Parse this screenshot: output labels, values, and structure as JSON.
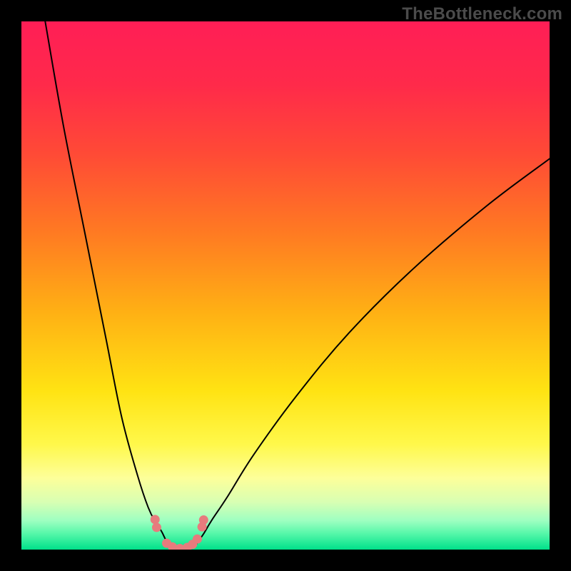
{
  "watermark": "TheBottleneck.com",
  "colors": {
    "frame": "#000000",
    "gradient_stops": [
      {
        "offset": 0.0,
        "color": "#ff1e56"
      },
      {
        "offset": 0.12,
        "color": "#ff2a4a"
      },
      {
        "offset": 0.25,
        "color": "#ff4a36"
      },
      {
        "offset": 0.4,
        "color": "#ff7a22"
      },
      {
        "offset": 0.55,
        "color": "#ffb014"
      },
      {
        "offset": 0.7,
        "color": "#ffe313"
      },
      {
        "offset": 0.8,
        "color": "#fff84a"
      },
      {
        "offset": 0.865,
        "color": "#fdff9a"
      },
      {
        "offset": 0.91,
        "color": "#d8ffb3"
      },
      {
        "offset": 0.945,
        "color": "#9effc1"
      },
      {
        "offset": 0.97,
        "color": "#55f7a9"
      },
      {
        "offset": 1.0,
        "color": "#00e08a"
      }
    ],
    "curve_stroke": "#000000",
    "marker_fill": "#e77b7d",
    "marker_stroke": "#e77b7d"
  },
  "chart_data": {
    "type": "line",
    "title": "",
    "xlabel": "",
    "ylabel": "",
    "xlim": [
      0,
      100
    ],
    "ylim": [
      0,
      100
    ],
    "series": [
      {
        "name": "left-curve",
        "x": [
          4.5,
          8,
          12,
          16,
          19,
          22,
          24,
          25.5,
          26.5,
          27.0,
          27.5,
          28.0
        ],
        "values": [
          100,
          80,
          60,
          40,
          25,
          14,
          8,
          5,
          3.5,
          2.5,
          1.5,
          0.8
        ]
      },
      {
        "name": "right-curve",
        "x": [
          33.0,
          33.5,
          34.5,
          36,
          39,
          44,
          52,
          62,
          74,
          88,
          100
        ],
        "values": [
          0.8,
          1.6,
          3.0,
          5.5,
          10,
          18,
          29,
          41,
          53,
          65,
          74
        ]
      },
      {
        "name": "valley-floor",
        "x": [
          28.0,
          29.0,
          30.0,
          31.0,
          32.0,
          33.0
        ],
        "values": [
          0.8,
          0.3,
          0.1,
          0.1,
          0.3,
          0.8
        ]
      }
    ],
    "markers": [
      {
        "x": 25.3,
        "y": 5.7
      },
      {
        "x": 25.6,
        "y": 4.2
      },
      {
        "x": 27.5,
        "y": 1.2
      },
      {
        "x": 28.6,
        "y": 0.5
      },
      {
        "x": 30.0,
        "y": 0.2
      },
      {
        "x": 31.4,
        "y": 0.4
      },
      {
        "x": 32.4,
        "y": 1.0
      },
      {
        "x": 33.3,
        "y": 2.0
      },
      {
        "x": 34.2,
        "y": 4.3
      },
      {
        "x": 34.5,
        "y": 5.6
      }
    ]
  }
}
